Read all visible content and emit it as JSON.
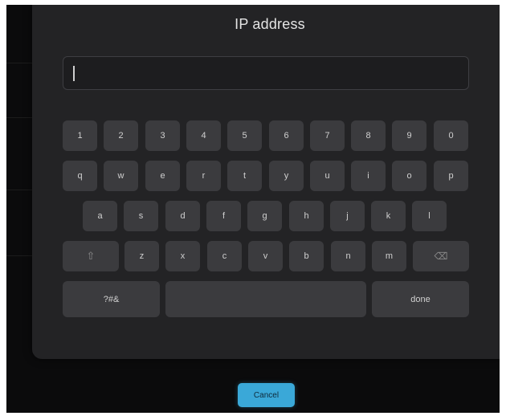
{
  "dialog": {
    "title": "IP address",
    "input_value": "",
    "input_placeholder": ""
  },
  "keyboard": {
    "row1": [
      "1",
      "2",
      "3",
      "4",
      "5",
      "6",
      "7",
      "8",
      "9",
      "0"
    ],
    "row2": [
      "q",
      "w",
      "e",
      "r",
      "t",
      "y",
      "u",
      "i",
      "o",
      "p"
    ],
    "row3": [
      "a",
      "s",
      "d",
      "f",
      "g",
      "h",
      "j",
      "k",
      "l"
    ],
    "row4": [
      "z",
      "x",
      "c",
      "v",
      "b",
      "n",
      "m"
    ],
    "shift_icon": "shift-arrow-icon",
    "backspace_icon": "backspace-icon",
    "symbols_label": "?#&",
    "space_label": "",
    "done_label": "done"
  },
  "cancel_label": "Cancel",
  "colors": {
    "dialog_bg": "#232325",
    "key_bg": "#3b3b3e",
    "accent": "#3aa8d8"
  }
}
